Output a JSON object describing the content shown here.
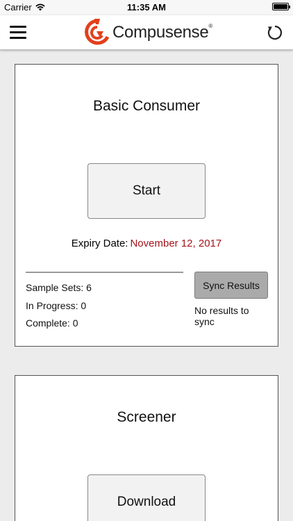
{
  "status_bar": {
    "carrier": "Carrier",
    "time": "11:35 AM"
  },
  "nav": {
    "brand_name": "Compusense",
    "brand_mark": "®",
    "menu_icon": "hamburger-menu-icon",
    "refresh_icon": "refresh-icon",
    "logo_color": "#e2401c"
  },
  "cards": [
    {
      "title": "Basic Consumer",
      "action_label": "Start",
      "expiry_label": "Expiry Date:",
      "expiry_value": "November 12, 2017",
      "stats": {
        "sample_sets": "Sample Sets: 6",
        "in_progress": "In Progress: 0",
        "complete": "Complete: 0"
      },
      "sync_label": "Sync Results",
      "sync_status": "No results to sync"
    },
    {
      "title": "Screener",
      "action_label": "Download"
    }
  ],
  "colors": {
    "expiry_date": "#a3151c",
    "sync_button": "#aaaaaa",
    "background": "#ececec"
  }
}
